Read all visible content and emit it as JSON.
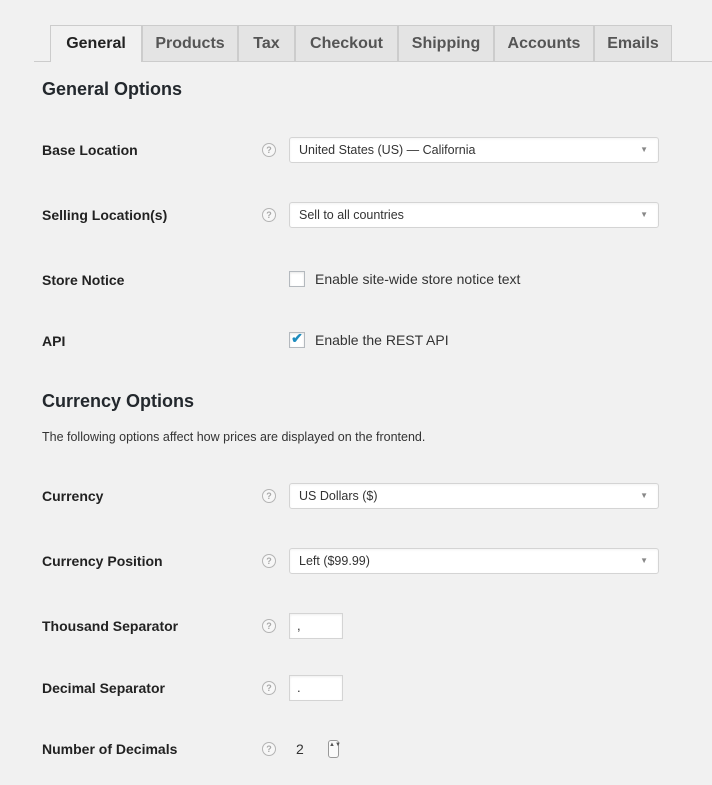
{
  "tabs": [
    {
      "label": "General",
      "active": true
    },
    {
      "label": "Products",
      "active": false
    },
    {
      "label": "Tax",
      "active": false
    },
    {
      "label": "Checkout",
      "active": false
    },
    {
      "label": "Shipping",
      "active": false
    },
    {
      "label": "Accounts",
      "active": false
    },
    {
      "label": "Emails",
      "active": false
    }
  ],
  "general_options": {
    "title": "General Options",
    "base_location": {
      "label": "Base Location",
      "value": "United States (US) — California"
    },
    "selling_locations": {
      "label": "Selling Location(s)",
      "value": "Sell to all countries"
    },
    "store_notice": {
      "label": "Store Notice",
      "checkbox_label": "Enable site-wide store notice text",
      "checked": false
    },
    "api": {
      "label": "API",
      "checkbox_label": "Enable the REST API",
      "checked": true
    }
  },
  "currency_options": {
    "title": "Currency Options",
    "description": "The following options affect how prices are displayed on the frontend.",
    "currency": {
      "label": "Currency",
      "value": "US Dollars ($)"
    },
    "currency_position": {
      "label": "Currency Position",
      "value": "Left ($99.99)"
    },
    "thousand_separator": {
      "label": "Thousand Separator",
      "value": ","
    },
    "decimal_separator": {
      "label": "Decimal Separator",
      "value": "."
    },
    "number_of_decimals": {
      "label": "Number of Decimals",
      "value": "2"
    }
  },
  "icons": {
    "help": "?",
    "dropdown_arrow": "▼",
    "checkmark": "✔",
    "stepper": "▲▼"
  },
  "colors": {
    "background": "#f1f1f1",
    "checkmark": "#1e8cbe",
    "inactive_tab": "#e4e4e4"
  }
}
